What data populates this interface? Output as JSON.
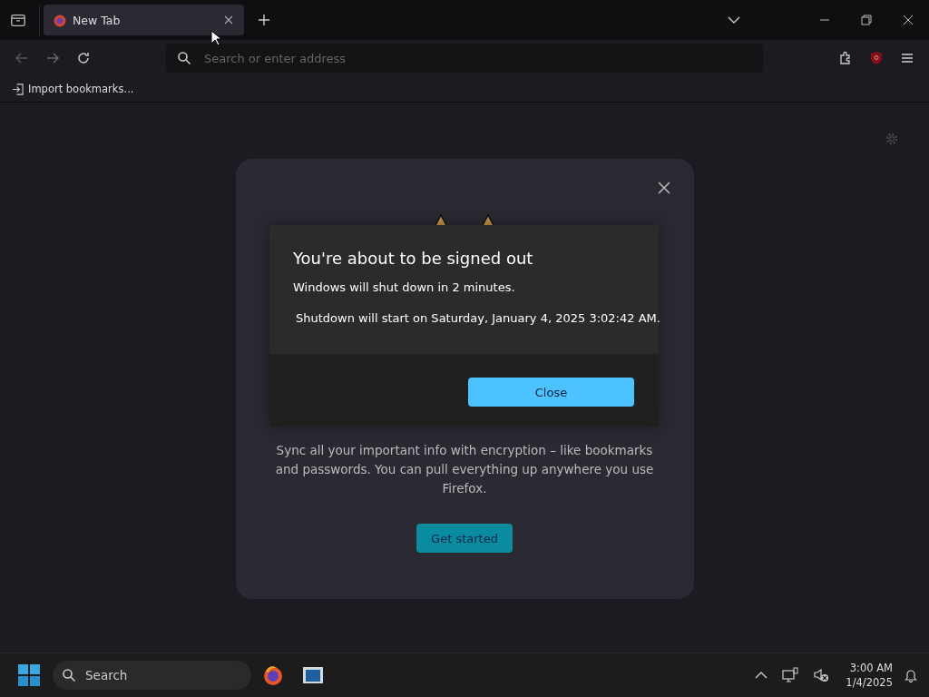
{
  "tabs": [
    {
      "title": "New Tab",
      "selected": true
    }
  ],
  "address_bar": {
    "placeholder": "Search or enter address"
  },
  "bookmarks_bar": {
    "items": [
      "Import bookmarks..."
    ]
  },
  "sync_card": {
    "body": "Sync all your important info with encryption – like bookmarks and passwords. You can pull everything up anywhere you use Firefox.",
    "button": "Get started"
  },
  "dialog": {
    "title": "You're about to be signed out",
    "message": "Windows will shut down in 2 minutes.",
    "detail": "Shutdown will start on Saturday, January 4, 2025 3:02:42 AM.",
    "button": "Close"
  },
  "taskbar": {
    "search": {
      "placeholder": "Search"
    },
    "clock": {
      "time": "3:00 AM",
      "date": "1/4/2025"
    }
  }
}
